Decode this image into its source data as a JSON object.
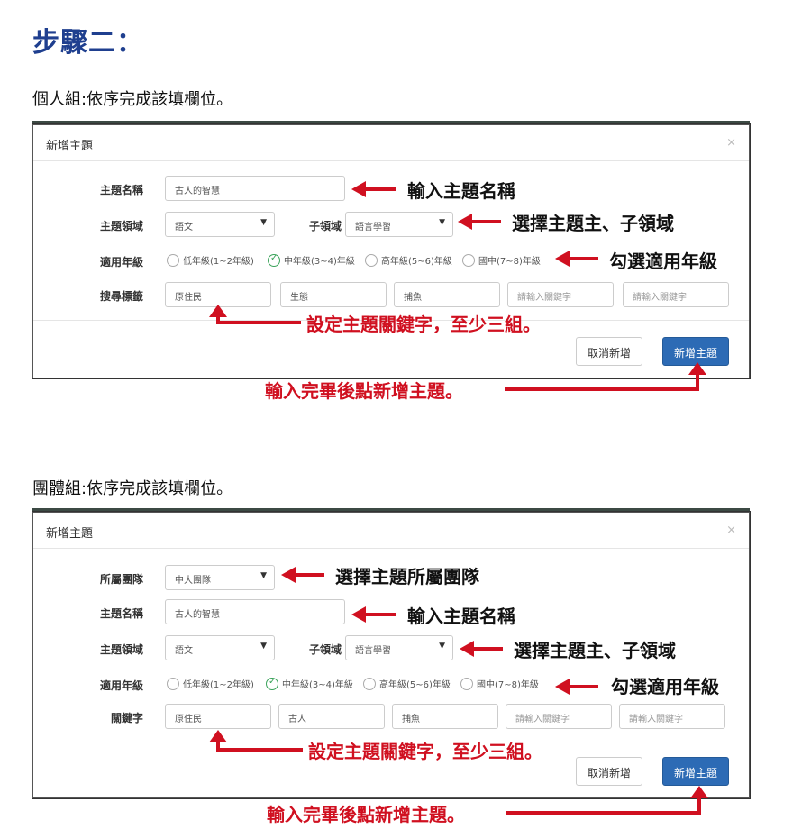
{
  "step_title": "步驟二：",
  "individual": {
    "desc": "個人組:依序完成該填欄位。",
    "modal_title": "新增主題",
    "close": "×",
    "labels": {
      "name": "主題名稱",
      "domain": "主題領域",
      "subdomain": "子領域",
      "grade": "適用年級",
      "keywords": "搜尋標籤"
    },
    "name_value": "古人的智慧",
    "domain_value": "語文",
    "subdomain_value": "語言學習",
    "grades": [
      "低年級(1~2年級)",
      "中年級(3~4)年級",
      "高年級(5~6)年級",
      "國中(7~8)年級"
    ],
    "grade_selected": 1,
    "keywords": [
      "原住民",
      "生態",
      "捕魚",
      "請輸入關鍵字",
      "請輸入關鍵字"
    ],
    "cancel": "取消新增",
    "add": "新增主題"
  },
  "group": {
    "desc": "團體組:依序完成該填欄位。",
    "modal_title": "新增主題",
    "close": "×",
    "labels": {
      "team": "所屬團隊",
      "name": "主題名稱",
      "domain": "主題領域",
      "subdomain": "子領域",
      "grade": "適用年級",
      "keywords": "關鍵字"
    },
    "team_value": "中大團隊",
    "name_value": "古人的智慧",
    "domain_value": "語文",
    "subdomain_value": "語言學習",
    "grades": [
      "低年級(1~2年級)",
      "中年級(3~4)年級",
      "高年級(5~6)年級",
      "國中(7~8)年級"
    ],
    "grade_selected": 1,
    "keywords": [
      "原住民",
      "古人",
      "捕魚",
      "請輸入關鍵字",
      "請輸入關鍵字"
    ],
    "cancel": "取消新增",
    "add": "新增主題"
  },
  "annotations": {
    "input_name": "輸入主題名稱",
    "select_domain": "選擇主題主、子領域",
    "check_grade": "勾選適用年級",
    "set_keywords": "設定主題關鍵字，至少三組。",
    "finish": "輸入完畢後點新增主題。",
    "select_team": "選擇主題所屬團隊"
  },
  "colors": {
    "accent_red": "#d01020",
    "primary_btn": "#2d6bb5",
    "title_blue": "#1f3f8f",
    "check_green": "#3aa35a"
  }
}
